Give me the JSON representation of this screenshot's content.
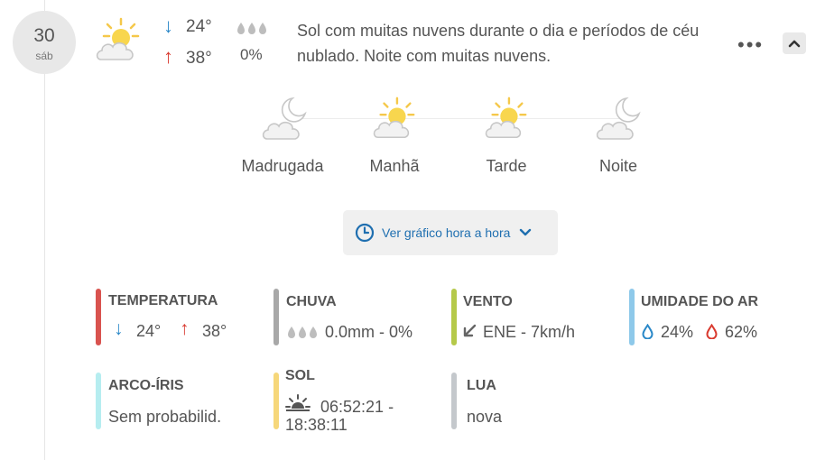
{
  "day": {
    "number": "30",
    "weekday": "sáb"
  },
  "summary": {
    "min_temp": "24°",
    "max_temp": "38°",
    "rain_prob": "0%",
    "description": "Sol com muitas nuvens durante o dia e períodos de céu nublado. Noite com muitas nuvens."
  },
  "periods": [
    {
      "label": "Madrugada",
      "icon": "moon-cloud-icon"
    },
    {
      "label": "Manhã",
      "icon": "sun-cloud-icon"
    },
    {
      "label": "Tarde",
      "icon": "sun-cloud-icon"
    },
    {
      "label": "Noite",
      "icon": "moon-cloud-icon"
    }
  ],
  "hourly_button": {
    "label": "Ver gráfico hora a hora"
  },
  "stats": {
    "temperature": {
      "title": "TEMPERATURA",
      "min": "24°",
      "max": "38°",
      "color": "#d9534f"
    },
    "rain": {
      "title": "CHUVA",
      "value": "0.0mm - 0%",
      "color": "#a8a8a8"
    },
    "wind": {
      "title": "VENTO",
      "value": "ENE - 7km/h",
      "color": "#b5c94a"
    },
    "humidity": {
      "title": "UMIDADE DO AR",
      "min": "24%",
      "max": "62%",
      "color": "#8ec9ea"
    },
    "rainbow": {
      "title": "ARCO-ÍRIS",
      "value": "Sem probabilid.",
      "color": "#b6edf0"
    },
    "sun": {
      "title": "SOL",
      "value_line1": "06:52:21 -",
      "value_line2": "18:38:11",
      "color": "#f6d77a"
    },
    "moon": {
      "title": "LUA",
      "value": "nova",
      "color": "#c4c8cc"
    }
  }
}
